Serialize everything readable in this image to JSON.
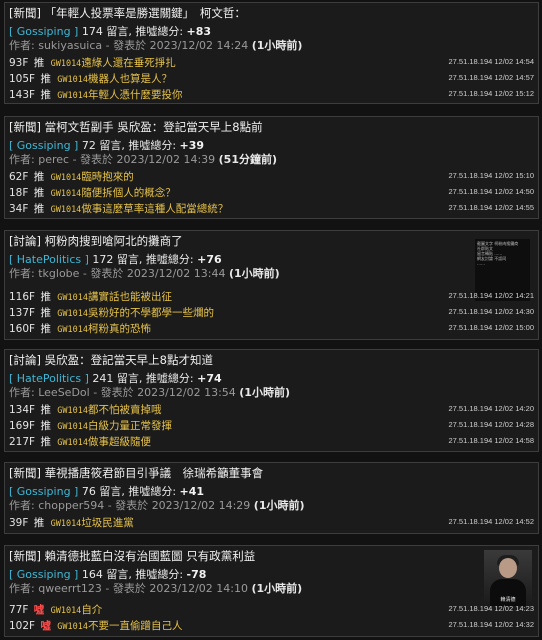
{
  "posts": [
    {
      "title": "[新聞] 「年輕人投票率是勝選關鍵」　柯文哲：",
      "board": "[ Gossiping ]",
      "comment_count": "174",
      "count_label": "留言, 推噓總分:",
      "score": "+83",
      "author_label": "作者:",
      "author": "sukiyasuica",
      "published_label": "- 發表於",
      "date": "2023/12/02 14:24",
      "relative": "(1小時前)",
      "pushes": [
        {
          "floor": "93F",
          "tag": "推",
          "uid": "GW1014",
          "text": "遠綠人還在垂死掙扎",
          "ip_time": "27.51.18.194 12/02 14:54"
        },
        {
          "floor": "105F",
          "tag": "推",
          "uid": "GW1014",
          "text": "機器人也算是人？",
          "ip_time": "27.51.18.194 12/02 14:57"
        },
        {
          "floor": "143F",
          "tag": "推",
          "uid": "GW1014",
          "text": "年輕人憑什麼要投你",
          "ip_time": "27.51.18.194 12/02 15:12"
        }
      ]
    },
    {
      "title": "[新聞] 當柯文哲副手 吳欣盈：登記當天早上8點前",
      "board": "[ Gossiping ]",
      "comment_count": "72",
      "count_label": "留言, 推噓總分:",
      "score": "+39",
      "author_label": "作者:",
      "author": "perec",
      "published_label": "- 發表於",
      "date": "2023/12/02 14:39",
      "relative": "(51分鐘前)",
      "pushes": [
        {
          "floor": "62F",
          "tag": "推",
          "uid": "GW1014",
          "text": "臨時抱來的",
          "ip_time": "27.51.18.194 12/02 15:10"
        },
        {
          "floor": "18F",
          "tag": "推",
          "uid": "GW1014",
          "text": "隨便拆個人的概念？",
          "ip_time": "27.51.18.194 12/02 14:50"
        },
        {
          "floor": "34F",
          "tag": "推",
          "uid": "GW1014",
          "text": "做事這麼草率這種人配當總統？",
          "ip_time": "27.51.18.194 12/02 14:55"
        }
      ]
    },
    {
      "title": "[討論] 柯粉肉搜到嗆阿北的攤商了",
      "board": "[ HatePolitics ]",
      "comment_count": "172",
      "count_label": "留言, 推噓總分:",
      "score": "+76",
      "author_label": "作者:",
      "author": "tkglobe",
      "published_label": "- 發表於",
      "date": "2023/12/02 13:44",
      "relative": "(1小時前)",
      "thumb_lines": [
        "截圖文字 柯粉肉搜攤商",
        "社群貼文",
        "留言轉貼 ……",
        "",
        "網友討論 不認同",
        "……"
      ],
      "pushes": [
        {
          "floor": "116F",
          "tag": "推",
          "uid": "GW1014",
          "text": "講實話也能被出征",
          "ip_time": "27.51.18.194 12/02 14:21"
        },
        {
          "floor": "137F",
          "tag": "推",
          "uid": "GW1014",
          "text": "吳粉好的不學都學一些爛的",
          "ip_time": "27.51.18.194 12/02 14:30"
        },
        {
          "floor": "160F",
          "tag": "推",
          "uid": "GW1014",
          "text": "柯粉真的恐怖",
          "ip_time": "27.51.18.194 12/02 15:00"
        }
      ]
    },
    {
      "title": "[討論] 吳欣盈：登記當天早上8點才知道",
      "board": "[ HatePolitics ]",
      "comment_count": "241",
      "count_label": "留言, 推噓總分:",
      "score": "+74",
      "author_label": "作者:",
      "author": "LeeSeDol",
      "published_label": "- 發表於",
      "date": "2023/12/02 13:54",
      "relative": "(1小時前)",
      "pushes": [
        {
          "floor": "134F",
          "tag": "推",
          "uid": "GW1014",
          "text": "都不怕被賣掉哦",
          "ip_time": "27.51.18.194 12/02 14:20"
        },
        {
          "floor": "169F",
          "tag": "推",
          "uid": "GW1014",
          "text": "白級力量正常發揮",
          "ip_time": "27.51.18.194 12/02 14:28"
        },
        {
          "floor": "217F",
          "tag": "推",
          "uid": "GW1014",
          "text": "做事超級隨便",
          "ip_time": "27.51.18.194 12/02 14:58"
        }
      ]
    },
    {
      "title": "[新聞] 華視播唐筱君節目引爭議　徐瑞希籲董事會",
      "board": "[ Gossiping ]",
      "comment_count": "76",
      "count_label": "留言, 推噓總分:",
      "score": "+41",
      "author_label": "作者:",
      "author": "chopper594",
      "published_label": "- 發表於",
      "date": "2023/12/02 14:29",
      "relative": "(1小時前)",
      "pushes": [
        {
          "floor": "39F",
          "tag": "推",
          "uid": "GW1014",
          "text": "垃圾民進黨",
          "ip_time": "27.51.18.194 12/02 14:52"
        }
      ]
    },
    {
      "title": "[新聞] 賴清德批藍白沒有治國藍圖 只有政黨利益",
      "board": "[ Gossiping ]",
      "comment_count": "164",
      "count_label": "留言, 推噓總分:",
      "score": "-78",
      "author_label": "作者:",
      "author": "qweerrt123",
      "published_label": "- 發表於",
      "date": "2023/12/02 14:10",
      "relative": "(1小時前)",
      "thumb_caption": "賴清德",
      "pushes": [
        {
          "floor": "77F",
          "tag": "噓",
          "uid": "GW1014",
          "text": "自介",
          "ip_time": "27.51.18.194 12/02 14:23"
        },
        {
          "floor": "102F",
          "tag": "噓",
          "uid": "GW1014",
          "text": "不要一直偷蹭自己人",
          "ip_time": "27.51.18.194 12/02 14:32"
        }
      ]
    }
  ]
}
